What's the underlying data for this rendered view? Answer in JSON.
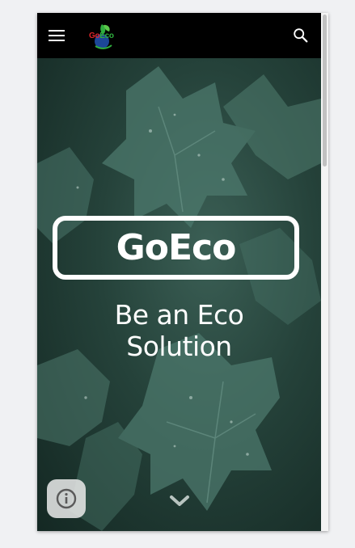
{
  "appbar": {
    "menu_icon": "menu-icon",
    "logo_text_part1": "Go",
    "logo_text_part2": "Eco",
    "search_icon": "search-icon"
  },
  "hero": {
    "brand_title": "GoEco",
    "tagline_line1": "Be an Eco",
    "tagline_line2": "Solution",
    "info_icon": "info-icon",
    "scroll_down_icon": "chevron-down-icon"
  },
  "colors": {
    "appbar_bg": "#000000",
    "logo_red": "#e0262b",
    "logo_green": "#2fae3e",
    "text": "#ffffff"
  }
}
